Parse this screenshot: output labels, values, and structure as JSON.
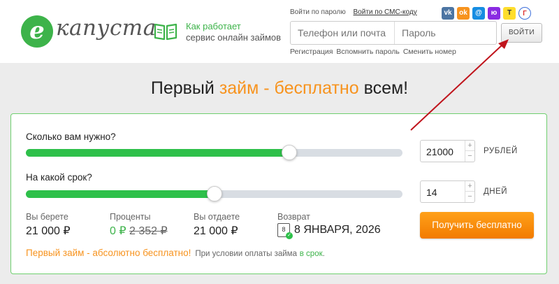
{
  "header": {
    "logo_letter": "е",
    "logo_text": "капуста",
    "how_line1": "Как работает",
    "how_line2": "сервис онлайн займов",
    "login_tab_password": "Войти по паролю",
    "login_tab_sms": "Войти по СМС-коду",
    "phone_placeholder": "Телефон или почта",
    "password_placeholder": "Пароль",
    "login_button": "ВОЙТИ",
    "link_register": "Регистрация",
    "link_remind": "Вспомнить пароль",
    "link_change": "Сменить номер",
    "social": [
      {
        "name": "vk-icon",
        "glyph": "vk"
      },
      {
        "name": "odnoklassniki-icon",
        "glyph": "ok"
      },
      {
        "name": "mail-icon",
        "glyph": "@"
      },
      {
        "name": "yoomoney-icon",
        "glyph": "ю"
      },
      {
        "name": "tinkoff-icon",
        "glyph": "T"
      },
      {
        "name": "gosuslugi-icon",
        "glyph": "Г"
      }
    ]
  },
  "headline": {
    "part1": "Первый ",
    "highlight": "займ - бесплатно",
    "part2": " всем!"
  },
  "calculator": {
    "amount_question": "Сколько вам нужно?",
    "amount_value": "21000",
    "amount_unit": "РУБЛЕЙ",
    "amount_fraction": 0.7,
    "term_question": "На какой срок?",
    "term_value": "14",
    "term_unit": "ДНЕЙ",
    "term_fraction": 0.5,
    "stepper_plus": "+",
    "stepper_minus": "−",
    "you_take_label": "Вы берете",
    "you_take_value": "21 000 ₽",
    "interest_label": "Проценты",
    "interest_new": "0 ₽",
    "interest_old": "2 352 ₽",
    "you_return_label": "Вы отдаете",
    "you_return_value": "21 000 ₽",
    "return_label": "Возврат",
    "return_day": "8",
    "return_date": "8 ЯНВАРЯ, 2026",
    "cta": "Получить бесплатно",
    "promo_main": "Первый займ - абсолютно бесплатно!",
    "promo_note": "При условии оплаты займа",
    "promo_link": "в срок",
    "promo_end": "."
  },
  "colors": {
    "brand_green": "#3db34a",
    "accent_orange": "#f7931e",
    "arrow_red": "#c0141c"
  }
}
